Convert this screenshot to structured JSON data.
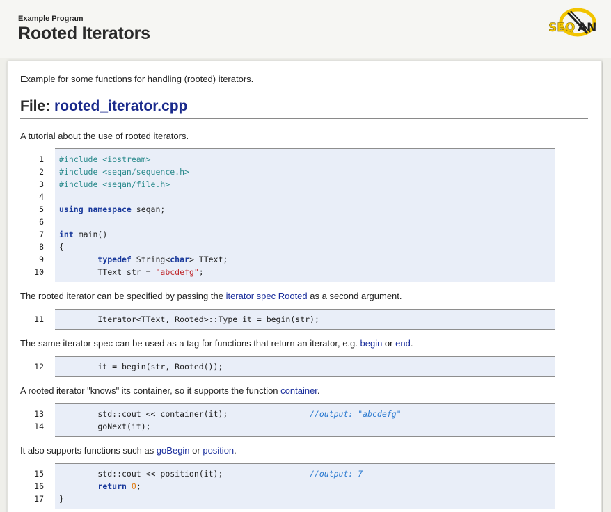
{
  "header": {
    "label": "Example Program",
    "title": "Rooted Iterators"
  },
  "logo": {
    "text": "SEQAN",
    "icon": "seqan-logo"
  },
  "intro": "Example for some functions for handling (rooted) iterators.",
  "file_heading": {
    "prefix": "File: ",
    "name": "rooted_iterator.cpp"
  },
  "tutorial": "A tutorial about the use of rooted iterators.",
  "code1": [
    {
      "n": "1",
      "t": "#include <iostream>"
    },
    {
      "n": "2",
      "t": "#include <seqan/sequence.h>"
    },
    {
      "n": "3",
      "t": "#include <seqan/file.h>"
    },
    {
      "n": "4",
      "t": ""
    },
    {
      "n": "5",
      "t": "using namespace seqan;"
    },
    {
      "n": "6",
      "t": ""
    },
    {
      "n": "7",
      "t": "int main()"
    },
    {
      "n": "8",
      "t": "{"
    },
    {
      "n": "9",
      "t": "        typedef String<char> TText;"
    },
    {
      "n": "10",
      "t": "        TText str = \"abcdefg\";"
    }
  ],
  "para2": {
    "before": "The rooted iterator can be specified by passing the ",
    "link": "iterator spec Rooted",
    "after": " as a second argument."
  },
  "code2": [
    {
      "n": "11",
      "t": "        Iterator<TText, Rooted>::Type it = begin(str);"
    }
  ],
  "para3": {
    "before": "The same iterator spec can be used as a tag for functions that return an iterator, e.g. ",
    "link1": "begin",
    "mid": " or ",
    "link2": "end",
    "after": "."
  },
  "code3": [
    {
      "n": "12",
      "t": "        it = begin(str, Rooted());"
    }
  ],
  "para4": {
    "before": "A rooted iterator \"knows\" its container, so it supports the function ",
    "link": "container",
    "after": "."
  },
  "code4": [
    {
      "n": "13",
      "t": "        std::cout << container(it);",
      "c": "//output: \"abcdefg\""
    },
    {
      "n": "14",
      "t": "        goNext(it);"
    }
  ],
  "para5": {
    "before": "It also supports functions such as ",
    "link1": "goBegin",
    "mid": " or ",
    "link2": "position",
    "after": "."
  },
  "code5": [
    {
      "n": "15",
      "t": "        std::cout << position(it);",
      "c": "//output: 7"
    },
    {
      "n": "16",
      "t": "        return 0;"
    },
    {
      "n": "17",
      "t": "}"
    }
  ]
}
